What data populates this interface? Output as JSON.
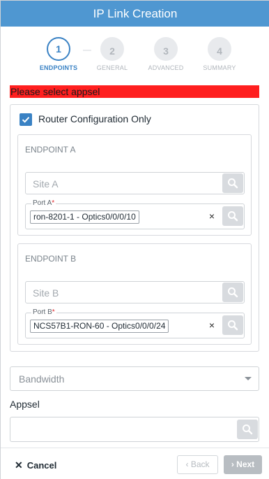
{
  "header": {
    "title": "IP Link Creation"
  },
  "steps": [
    {
      "num": "1",
      "label": "ENDPOINTS"
    },
    {
      "num": "2",
      "label": "GENERAL"
    },
    {
      "num": "3",
      "label": "ADVANCED"
    },
    {
      "num": "4",
      "label": "SUMMARY"
    }
  ],
  "error_message": "Please select appsel",
  "router_config": {
    "label": "Router Configuration Only",
    "checked": true
  },
  "endpoint_a": {
    "title": "ENDPOINT A",
    "site_placeholder": "Site A",
    "port_label": "Port A",
    "port_value": "ron-8201-1 - Optics0/0/0/10"
  },
  "endpoint_b": {
    "title": "ENDPOINT B",
    "site_placeholder": "Site B",
    "port_label": "Port B",
    "port_value": "NCS57B1-RON-60 - Optics0/0/0/24"
  },
  "required_mark": "*",
  "bandwidth": {
    "placeholder": "Bandwidth"
  },
  "appsel": {
    "label": "Appsel"
  },
  "footer": {
    "cancel": "Cancel",
    "back": "Back",
    "next": "Next"
  },
  "icons": {
    "clear": "×",
    "cancel": "✕",
    "back": "‹",
    "next": "›"
  },
  "colors": {
    "header": "#4f97d1",
    "accent": "#3a82c4",
    "error": "#ff1f1f"
  }
}
